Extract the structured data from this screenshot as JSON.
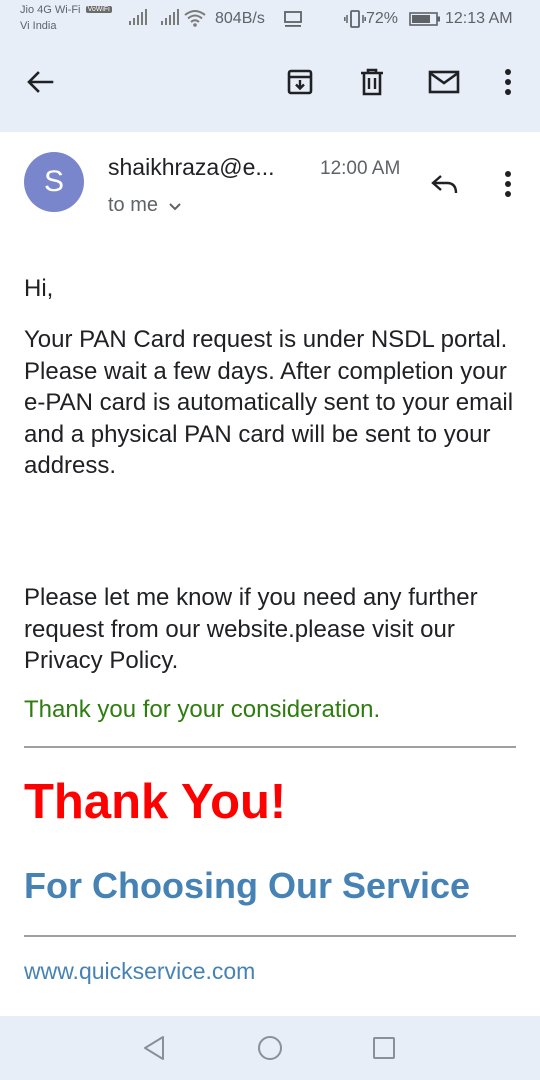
{
  "status_bar": {
    "carrier_primary": "Jio 4G Wi-Fi",
    "vowifi_badge": "VoWiFi",
    "carrier_secondary": "Vi India",
    "network_speed": "804B/s",
    "battery_percent": "72%",
    "time": "12:13 AM"
  },
  "toolbar": {
    "icons": [
      "back-arrow-icon",
      "archive-icon",
      "delete-icon",
      "mark-unread-icon",
      "more-vert-icon"
    ]
  },
  "message_header": {
    "avatar_initial": "S",
    "avatar_color": "#7986cb",
    "sender": "shaikhraza@e...",
    "time": "12:00 AM",
    "recipient": "to me"
  },
  "body": {
    "greeting": "Hi,",
    "paragraph_1": "Your PAN Card request is under NSDL portal. Please wait a few days. After completion your e-PAN card is automatically sent to your email and a physical PAN card will be sent to your address.",
    "paragraph_2": "Please let me know if you need any further request from our website.please visit our Privacy Policy.",
    "thanks_line": "Thank you for your consideration.",
    "headline": "Thank You!",
    "subheadline": "For Choosing Our Service",
    "website": "www.quickservice.com"
  },
  "colors": {
    "chrome_bg": "#e8eef7",
    "thanks_green": "#2e7d0f",
    "headline_red": "#ff0000",
    "subheadline_blue": "#4682b4"
  }
}
